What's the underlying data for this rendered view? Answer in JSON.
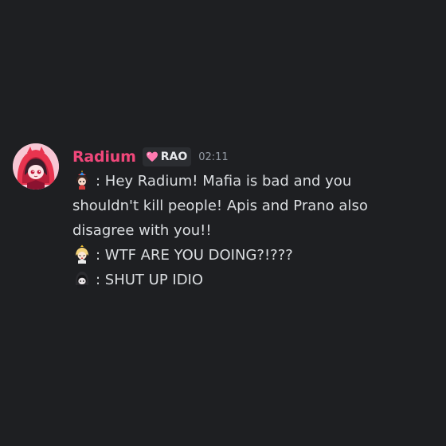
{
  "message": {
    "author": "Radium",
    "role_tag": {
      "icon": "pink-heart-icon",
      "label": "RAO",
      "icon_color": "#ff7ab0"
    },
    "timestamp": "02:11",
    "name_color": "#f0477a",
    "lines": [
      {
        "emoji": "propeller-hat-girl-emoji",
        "text": ": Hey Radium! Mafia is bad and you"
      },
      {
        "emoji": null,
        "text": "shouldn't kill people! Apis and Prano also"
      },
      {
        "emoji": null,
        "text": "disagree with you!!"
      },
      {
        "emoji": "blonde-character-emoji",
        "text": ": WTF ARE YOU DOING?!???"
      },
      {
        "emoji": "dark-hooded-character-emoji",
        "text": ": SHUT UP IDIO"
      }
    ]
  },
  "colors": {
    "background": "#1e1f22",
    "text": "#dbdee1",
    "muted": "#949ba4"
  }
}
